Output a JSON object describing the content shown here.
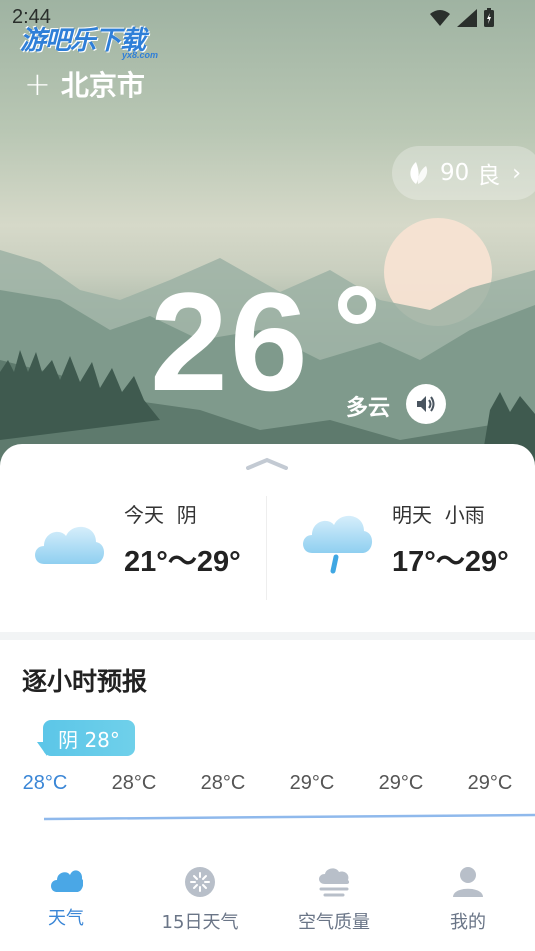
{
  "status_bar": {
    "time": "2:44"
  },
  "watermark": {
    "text": "游吧乐下载",
    "sub": "yx8.com"
  },
  "header": {
    "add_icon": "plus-icon",
    "city": "北京市"
  },
  "aqi": {
    "value": "90",
    "level": "良",
    "icon": "leaf-icon"
  },
  "current": {
    "temperature": "26",
    "condition": "多云",
    "speaker_icon": "speaker-icon"
  },
  "daily": [
    {
      "day": "今天",
      "condition": "阴",
      "range": "21°～29°",
      "icon": "cloud-icon"
    },
    {
      "day": "明天",
      "condition": "小雨",
      "range": "17°～29°",
      "icon": "rain-cloud-icon"
    }
  ],
  "hourly": {
    "title": "逐小时预报",
    "bubble": "阴 28°",
    "temps": [
      "28°C",
      "28°C",
      "28°C",
      "29°C",
      "29°C",
      "29°C"
    ]
  },
  "tabs": [
    {
      "label": "天气",
      "icon": "cloud-icon",
      "active": true
    },
    {
      "label": "15日天气",
      "icon": "calendar-icon",
      "active": false
    },
    {
      "label": "空气质量",
      "icon": "haze-icon",
      "active": false
    },
    {
      "label": "我的",
      "icon": "user-icon",
      "active": false
    }
  ],
  "colors": {
    "accent": "#3a86d6",
    "bubble": "#5cc6e8",
    "inactive_tab": "#6a7587"
  }
}
